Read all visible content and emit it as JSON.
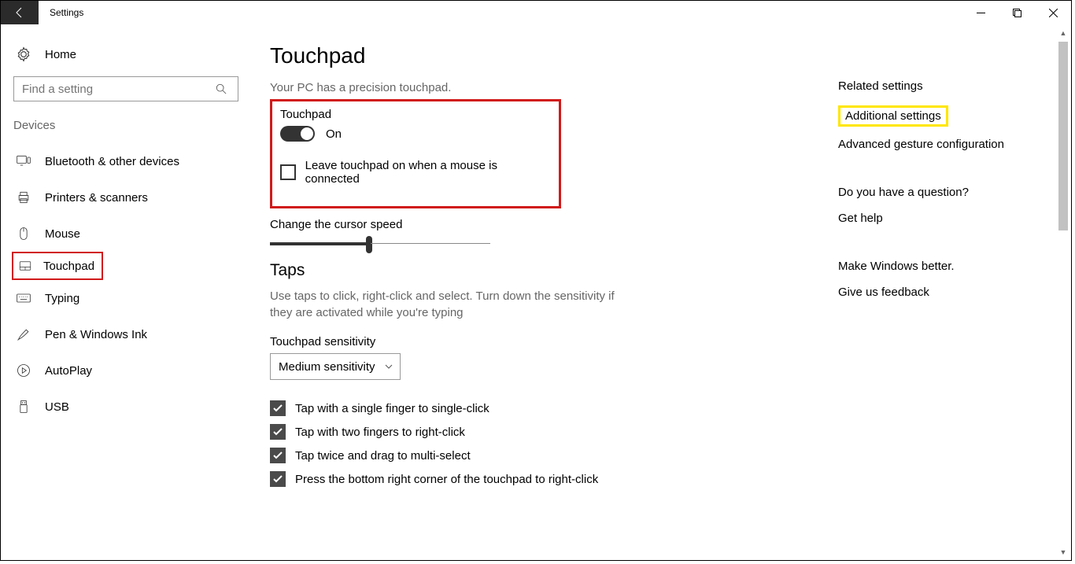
{
  "titlebar": {
    "app_name": "Settings"
  },
  "sidebar": {
    "home": "Home",
    "search_placeholder": "Find a setting",
    "group": "Devices",
    "items": [
      {
        "label": "Bluetooth & other devices"
      },
      {
        "label": "Printers & scanners"
      },
      {
        "label": "Mouse"
      },
      {
        "label": "Touchpad"
      },
      {
        "label": "Typing"
      },
      {
        "label": "Pen & Windows Ink"
      },
      {
        "label": "AutoPlay"
      },
      {
        "label": "USB"
      }
    ]
  },
  "main": {
    "title": "Touchpad",
    "precision_text": "Your PC has a precision touchpad.",
    "touchpad_label": "Touchpad",
    "toggle_state": "On",
    "leave_on_label": "Leave touchpad on when a mouse is connected",
    "cursor_speed_label": "Change the cursor speed",
    "taps_heading": "Taps",
    "taps_desc": "Use taps to click, right-click and select. Turn down the sensitivity if they are activated while you're typing",
    "sensitivity_label": "Touchpad sensitivity",
    "sensitivity_value": "Medium sensitivity",
    "checks": [
      "Tap with a single finger to single-click",
      "Tap with two fingers to right-click",
      "Tap twice and drag to multi-select",
      "Press the bottom right corner of the touchpad to right-click"
    ]
  },
  "right": {
    "related_head": "Related settings",
    "additional": "Additional settings",
    "advanced": "Advanced gesture configuration",
    "question_head": "Do you have a question?",
    "get_help": "Get help",
    "better_head": "Make Windows better.",
    "feedback": "Give us feedback"
  }
}
